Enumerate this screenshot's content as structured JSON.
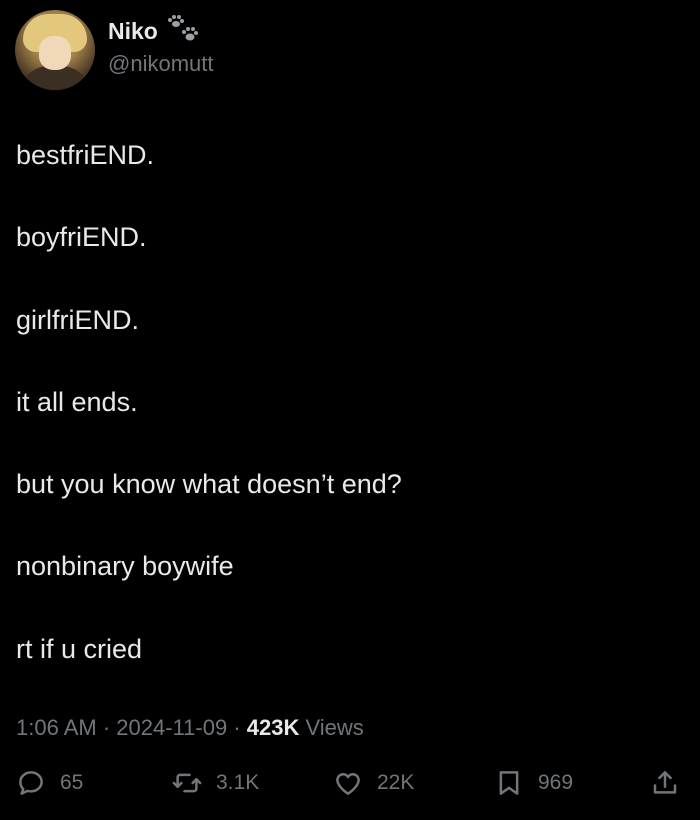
{
  "user": {
    "name": "Niko",
    "handle": "@nikomutt"
  },
  "tweet": {
    "lines": [
      "bestfriEND.",
      "boyfriEND.",
      "girlfriEND.",
      "it all ends.",
      "but you know what doesn’t end?",
      "nonbinary boywife",
      "rt if u cried"
    ]
  },
  "meta": {
    "time": "1:06 AM",
    "date": "2024-11-09",
    "views_count": "423K",
    "views_label": "Views"
  },
  "actions": {
    "replies": "65",
    "retweets": "3.1K",
    "likes": "22K",
    "bookmarks": "969"
  },
  "icons": [
    "paw-prints-icon",
    "reply-icon",
    "retweet-icon",
    "like-icon",
    "bookmark-icon",
    "share-icon"
  ],
  "colors": {
    "background": "#000000",
    "text": "#e7e9ea",
    "secondary": "#71767b"
  }
}
